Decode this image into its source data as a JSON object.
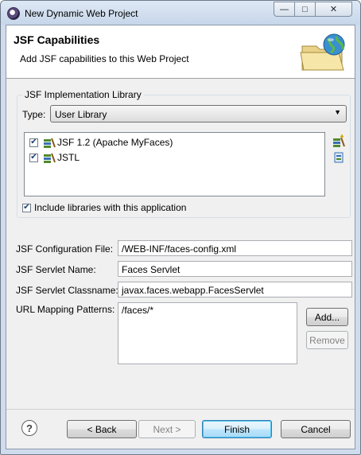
{
  "window": {
    "title": "New Dynamic Web Project",
    "controls": {
      "minimize": "—",
      "maximize": "□",
      "close": "✕"
    }
  },
  "header": {
    "title": "JSF Capabilities",
    "description": "Add JSF capabilities to this Web Project",
    "icon": "folder-globe-icon"
  },
  "implementation": {
    "group_label": "JSF Implementation Library",
    "type_label": "Type:",
    "type_value": "User Library",
    "libraries": [
      {
        "label": "JSF 1.2 (Apache MyFaces)",
        "checked": true
      },
      {
        "label": "JSTL",
        "checked": true
      }
    ],
    "include_label": "Include libraries with this application",
    "include_checked": true
  },
  "config": {
    "config_file_label": "JSF Configuration File:",
    "config_file_value": "/WEB-INF/faces-config.xml",
    "servlet_name_label": "JSF Servlet Name:",
    "servlet_name_value": "Faces Servlet",
    "servlet_class_label": "JSF Servlet Classname:",
    "servlet_class_value": "javax.faces.webapp.FacesServlet",
    "url_mapping_label": "URL Mapping Patterns:",
    "url_mapping_items": [
      "/faces/*"
    ],
    "add_label": "Add...",
    "remove_label": "Remove"
  },
  "footer": {
    "help": "?",
    "back_label": "< Back",
    "next_label": "Next >",
    "finish_label": "Finish",
    "cancel_label": "Cancel"
  }
}
